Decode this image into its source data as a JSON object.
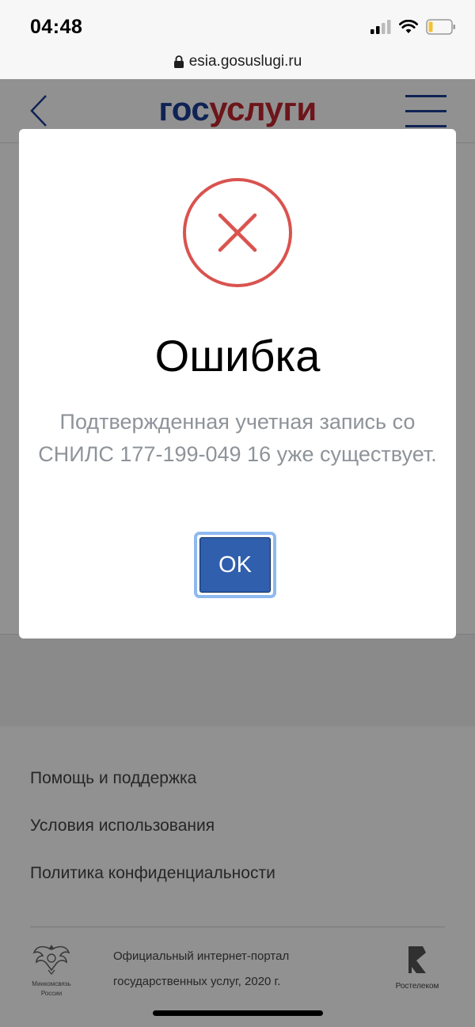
{
  "status_bar": {
    "time": "04:48",
    "icons": [
      "signal-icon",
      "wifi-icon",
      "battery-icon"
    ]
  },
  "browser": {
    "url": "esia.gosuslugi.ru"
  },
  "header": {
    "logo_part1": "гос",
    "logo_part2": "услуги",
    "brand_colors": {
      "blue": "#1c3f94",
      "red": "#c0252f"
    }
  },
  "dialog": {
    "title": "Ошибка",
    "message": "Подтвержденная учетная запись со СНИЛС 177-199-049 16 уже существует.",
    "ok_label": "OK",
    "icon": "error-cross-icon",
    "accent_color": "#d9534f",
    "button_color": "#2f5fad"
  },
  "footer": {
    "links": [
      {
        "label": "Помощь и поддержка"
      },
      {
        "label": "Условия использования"
      },
      {
        "label": "Политика конфиденциальности"
      }
    ],
    "emblem_line1": "Минкомсвязь",
    "emblem_line2": "России",
    "portal_line1": "Официальный интернет-портал",
    "portal_line2": "государственных услуг, 2020 г.",
    "partner": "Ростелеком"
  }
}
